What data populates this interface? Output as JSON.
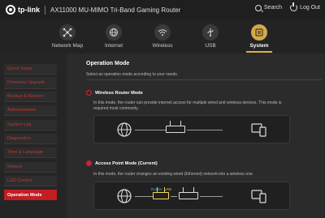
{
  "header": {
    "brand": "tp-link",
    "model": "AX11000 MU-MIMO Tri-Band Gaming Router",
    "search_label": "Search",
    "logout_label": "Log Out"
  },
  "nav": {
    "items": [
      {
        "label": "Network Map",
        "icon": "network-map-icon"
      },
      {
        "label": "Internet",
        "icon": "globe-icon"
      },
      {
        "label": "Wireless",
        "icon": "wifi-icon"
      },
      {
        "label": "USB",
        "icon": "usb-icon"
      },
      {
        "label": "System",
        "icon": "system-icon",
        "active": true
      }
    ],
    "accent_color": "#d4a84a"
  },
  "sidebar": {
    "items": [
      {
        "label": "Quick Setup"
      },
      {
        "label": "Firmware Upgrade"
      },
      {
        "label": "Backup & Restore"
      },
      {
        "label": "Administration"
      },
      {
        "label": "System Log"
      },
      {
        "label": "Diagnostics"
      },
      {
        "label": "Time & Language"
      },
      {
        "label": "Reboot"
      },
      {
        "label": "LED Control"
      },
      {
        "label": "Operation Mode",
        "active": true
      }
    ],
    "active_color": "#c21d22"
  },
  "main": {
    "title": "Operation Mode",
    "description": "Select an operation mode according to your needs.",
    "options": [
      {
        "label": "Wireless Router Mode",
        "selected": false,
        "description": "In this mode, the router can provide internet access for multiple wired and wireless devices. This mode is required most commonly."
      },
      {
        "label": "Access Point Mode (Current)",
        "selected": true,
        "description": "In this mode, the router changes an existing wired (Ethernet) network into a wireless one.",
        "diagram_labels": {
          "router": "Router",
          "lan": "LAN"
        }
      }
    ]
  }
}
